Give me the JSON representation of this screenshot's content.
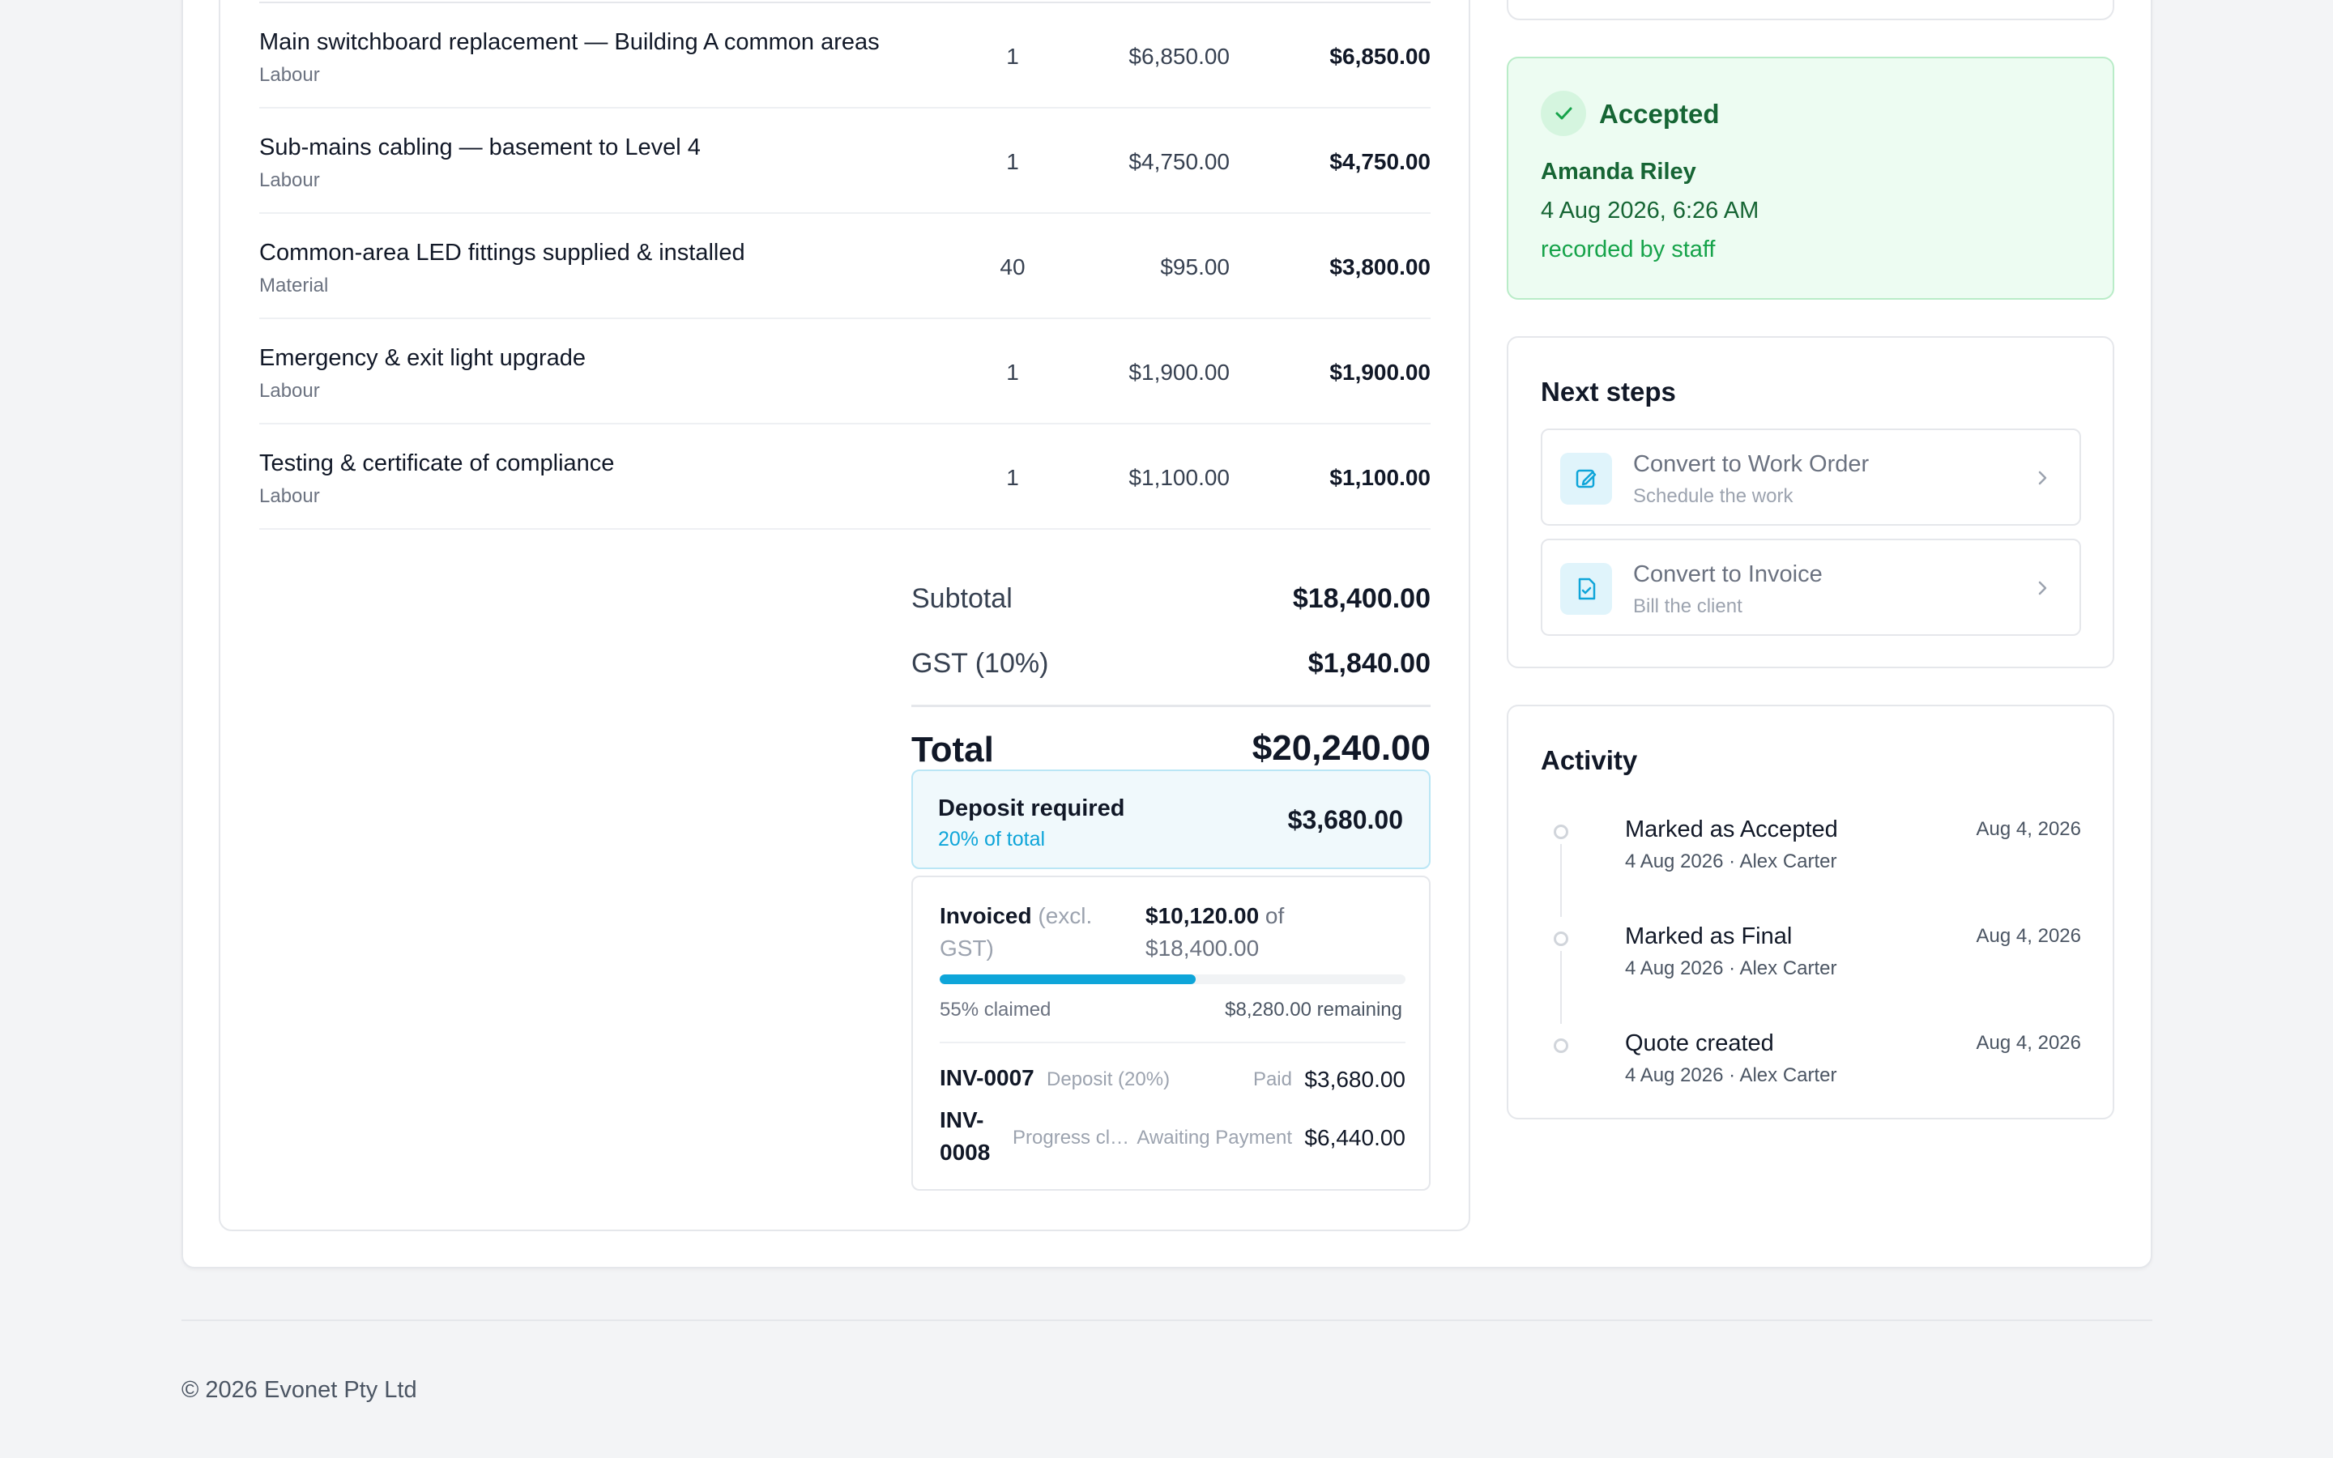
{
  "line_items": [
    {
      "name": "Main switchboard replacement — Building A common areas",
      "type": "Labour",
      "qty": "1",
      "price": "$6,850.00",
      "total": "$6,850.00"
    },
    {
      "name": "Sub-mains cabling — basement to Level 4",
      "type": "Labour",
      "qty": "1",
      "price": "$4,750.00",
      "total": "$4,750.00"
    },
    {
      "name": "Common-area LED fittings supplied & installed",
      "type": "Material",
      "qty": "40",
      "price": "$95.00",
      "total": "$3,800.00"
    },
    {
      "name": "Emergency & exit light upgrade",
      "type": "Labour",
      "qty": "1",
      "price": "$1,900.00",
      "total": "$1,900.00"
    },
    {
      "name": "Testing & certificate of compliance",
      "type": "Labour",
      "qty": "1",
      "price": "$1,100.00",
      "total": "$1,100.00"
    }
  ],
  "totals": {
    "subtotal_label": "Subtotal",
    "subtotal": "$18,400.00",
    "gst_label": "GST (10%)",
    "gst": "$1,840.00",
    "total_label": "Total",
    "total": "$20,240.00"
  },
  "deposit": {
    "title": "Deposit required",
    "subtitle": "20% of total",
    "amount": "$3,680.00"
  },
  "invoiced": {
    "label": "Invoiced",
    "label_note": "(excl. GST)",
    "claimed_amount": "$10,120.00",
    "of_word": "of",
    "of_amount": "$18,400.00",
    "progress_fraction": 0.55,
    "claimed_text": "55% claimed",
    "remaining_text": "$8,280.00 remaining",
    "invoices": [
      {
        "number": "INV-0007",
        "desc": "Deposit (20%)",
        "status": "Paid",
        "amount": "$3,680.00"
      },
      {
        "number_line1": "INV-",
        "number_line2": "0008",
        "desc": "Progress cl…",
        "status": "Awaiting Payment",
        "amount": "$6,440.00"
      }
    ]
  },
  "accepted": {
    "title": "Accepted",
    "name": "Amanda Riley",
    "date": "4 Aug 2026, 6:26 AM",
    "recorded_by": "recorded by staff"
  },
  "next_steps": {
    "title": "Next steps",
    "items": [
      {
        "title": "Convert to Work Order",
        "subtitle": "Schedule the work",
        "icon": "edit-icon"
      },
      {
        "title": "Convert to Invoice",
        "subtitle": "Bill the client",
        "icon": "invoice-icon"
      }
    ]
  },
  "activity": {
    "title": "Activity",
    "items": [
      {
        "title": "Marked as Accepted",
        "meta": "4 Aug 2026 · Alex Carter",
        "date": "Aug 4, 2026"
      },
      {
        "title": "Marked as Final",
        "meta": "4 Aug 2026 · Alex Carter",
        "date": "Aug 4, 2026"
      },
      {
        "title": "Quote created",
        "meta": "4 Aug 2026 · Alex Carter",
        "date": "Aug 4, 2026"
      }
    ]
  },
  "footer": {
    "copyright": "© 2026 Evonet Pty Ltd"
  },
  "colors": {
    "accent": "#0ea5d9",
    "success": "#166534",
    "success_bg": "#edfcf2"
  }
}
